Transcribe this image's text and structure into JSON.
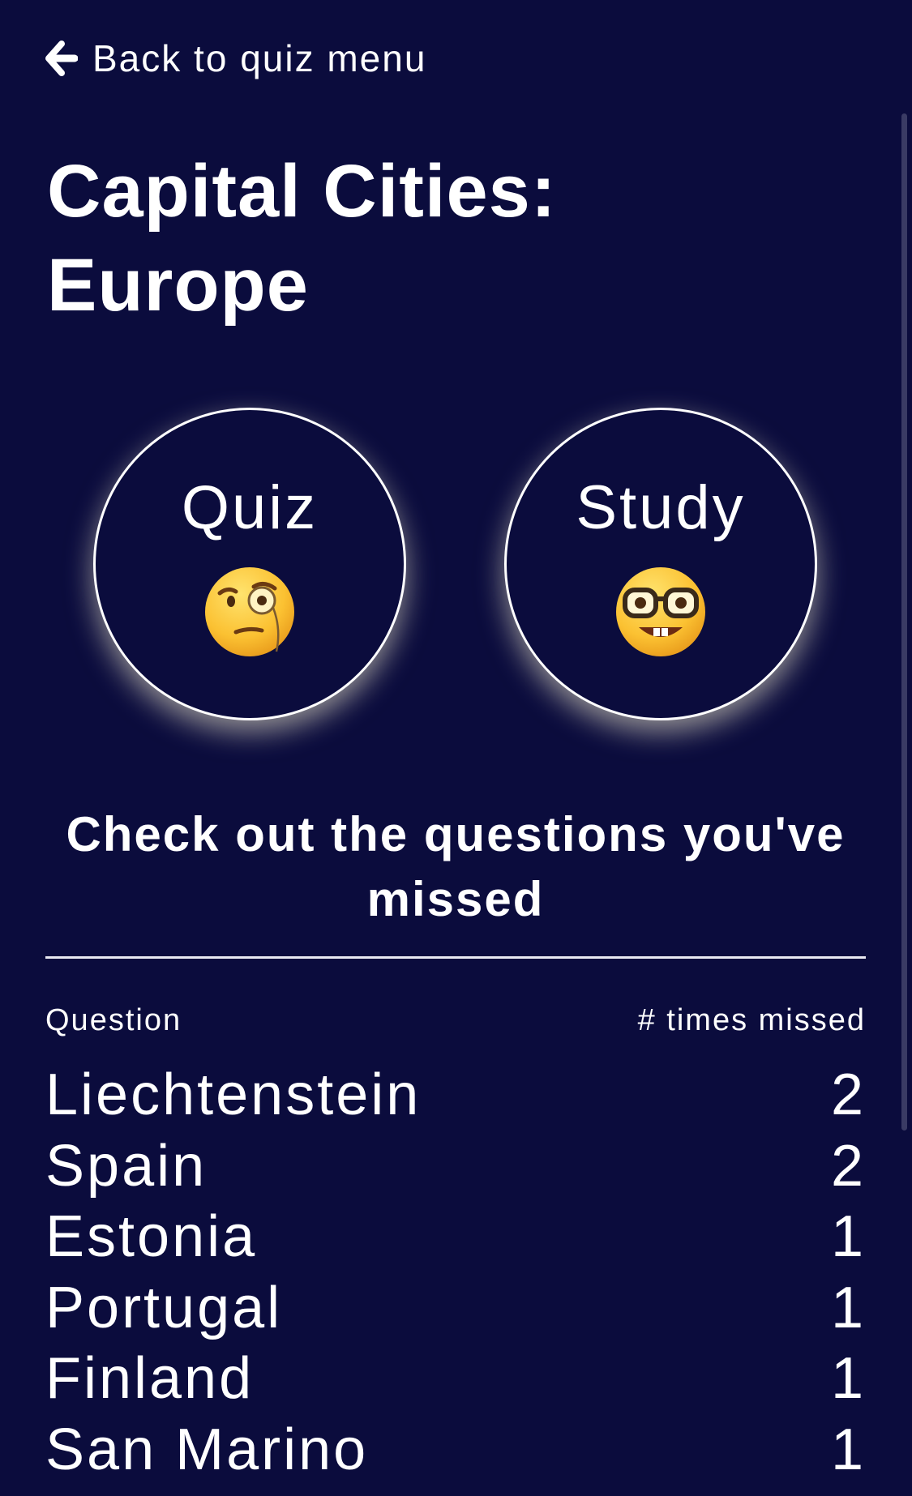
{
  "nav": {
    "back_label": "Back to quiz menu"
  },
  "page": {
    "title": "Capital Cities: Europe"
  },
  "modes": [
    {
      "label": "Quiz",
      "emoji": "face-with-monocle-icon"
    },
    {
      "label": "Study",
      "emoji": "nerd-face-icon"
    }
  ],
  "missed": {
    "heading": "Check out the questions you've missed",
    "column_question": "Question",
    "column_count": "# times missed",
    "rows": [
      {
        "question": "Liechtenstein",
        "count": "2"
      },
      {
        "question": "Spain",
        "count": "2"
      },
      {
        "question": "Estonia",
        "count": "1"
      },
      {
        "question": "Portugal",
        "count": "1"
      },
      {
        "question": "Finland",
        "count": "1"
      },
      {
        "question": "San Marino",
        "count": "1"
      }
    ]
  },
  "colors": {
    "background": "#0b0c3d",
    "text": "#ffffff",
    "glow": "#fffad7"
  }
}
